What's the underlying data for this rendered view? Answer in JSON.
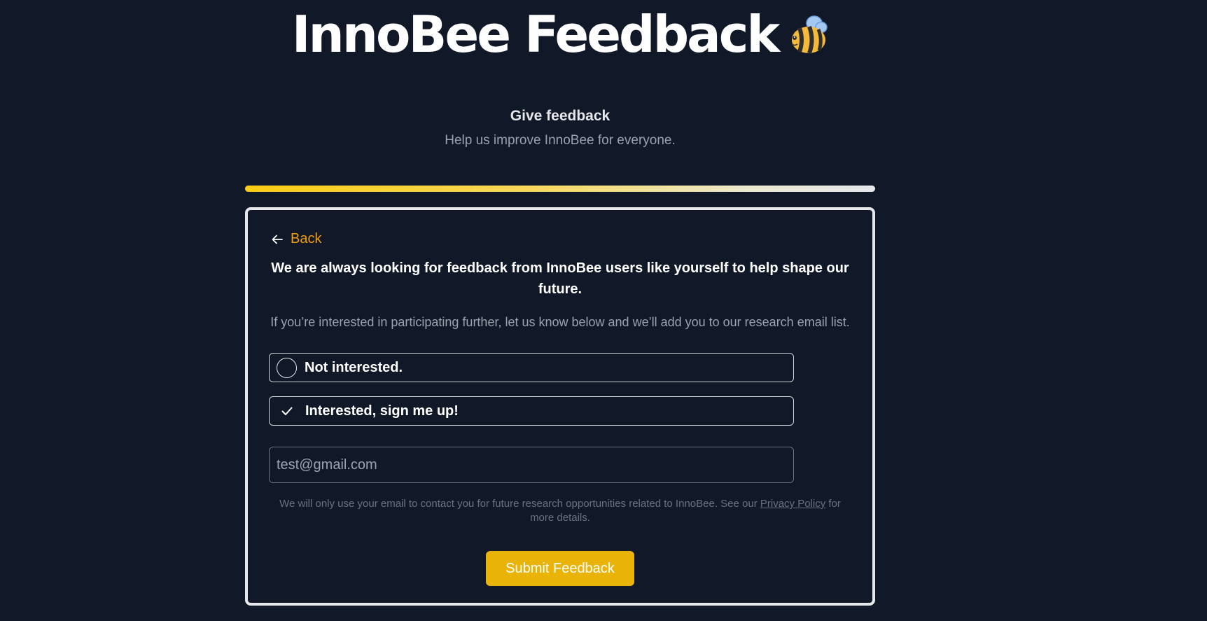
{
  "header": {
    "app_title": "InnoBee Feedback",
    "logo_icon": "bee-icon"
  },
  "intro": {
    "heading": "Give feedback",
    "subheading": "Help us improve InnoBee for everyone."
  },
  "progress": {
    "fraction": 1.0
  },
  "card": {
    "back_label": "Back",
    "back_icon": "arrow-left-icon",
    "question": "We are always looking for feedback from InnoBee users like yourself to help shape our future.",
    "description": "If you’re interested in participating further, let us know below and we’ll add you to our research email list.",
    "options": [
      {
        "label": "Not interested.",
        "selected": false
      },
      {
        "label": "Interested, sign me up!",
        "selected": true
      }
    ],
    "email": {
      "value": "",
      "placeholder": "test@gmail.com"
    },
    "disclaimer_before": "We will only use your email to contact you for future research opportunities related to InnoBee. See our ",
    "privacy_link": "Privacy Policy",
    "disclaimer_after": " for more details.",
    "submit_label": "Submit Feedback"
  },
  "colors": {
    "background": "#111827",
    "accent": "#eab308",
    "link": "#f59e0b",
    "border": "#e5e7eb"
  }
}
